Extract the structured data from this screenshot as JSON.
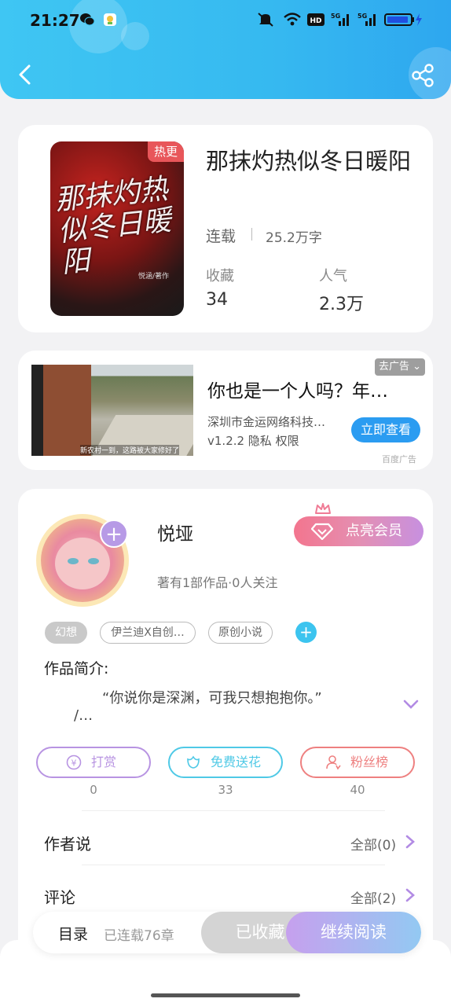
{
  "status": {
    "time": "21:27"
  },
  "book": {
    "title": "那抹灼热似冬日暖阳",
    "cover_badge": "热更",
    "cover_title": "那抹灼热似冬日暖阳",
    "cover_author": "悦涵/著作",
    "status": "连载",
    "words": "25.2万字",
    "fav_label": "收藏",
    "fav_value": "34",
    "pop_label": "人气",
    "pop_value": "2.3万"
  },
  "ad": {
    "remove_label": "去广告",
    "title": "你也是一个人吗？年…",
    "company": "深圳市金运网络科技…",
    "version": "v1.2.2  隐私  权限",
    "cta": "立即查看",
    "source": "百度广告",
    "image_caption": "新农村一到，这路被大家修好了"
  },
  "author": {
    "name": "悦垭",
    "works": "著有1部作品·0人关注",
    "vip_label": "点亮会员",
    "tags": [
      "幻想",
      "伊兰迪X自创…",
      "原创小说"
    ]
  },
  "intro": {
    "heading": "作品简介:",
    "line1": "“你说你是深渊，可我只想抱抱你。”",
    "line2": "/…"
  },
  "actions": [
    {
      "label": "打赏",
      "count": "0",
      "color": "#b894e2"
    },
    {
      "label": "免费送花",
      "count": "33",
      "color": "#4fc9e6"
    },
    {
      "label": "粉丝榜",
      "count": "40",
      "color": "#ee8080"
    }
  ],
  "rows": [
    {
      "label": "作者说",
      "right": "全部(0)"
    },
    {
      "label": "评论",
      "right": "全部(2)"
    }
  ],
  "bottom": {
    "toc": "目录",
    "chapters": "已连载76章",
    "fav": "已收藏",
    "read": "继续阅读"
  }
}
